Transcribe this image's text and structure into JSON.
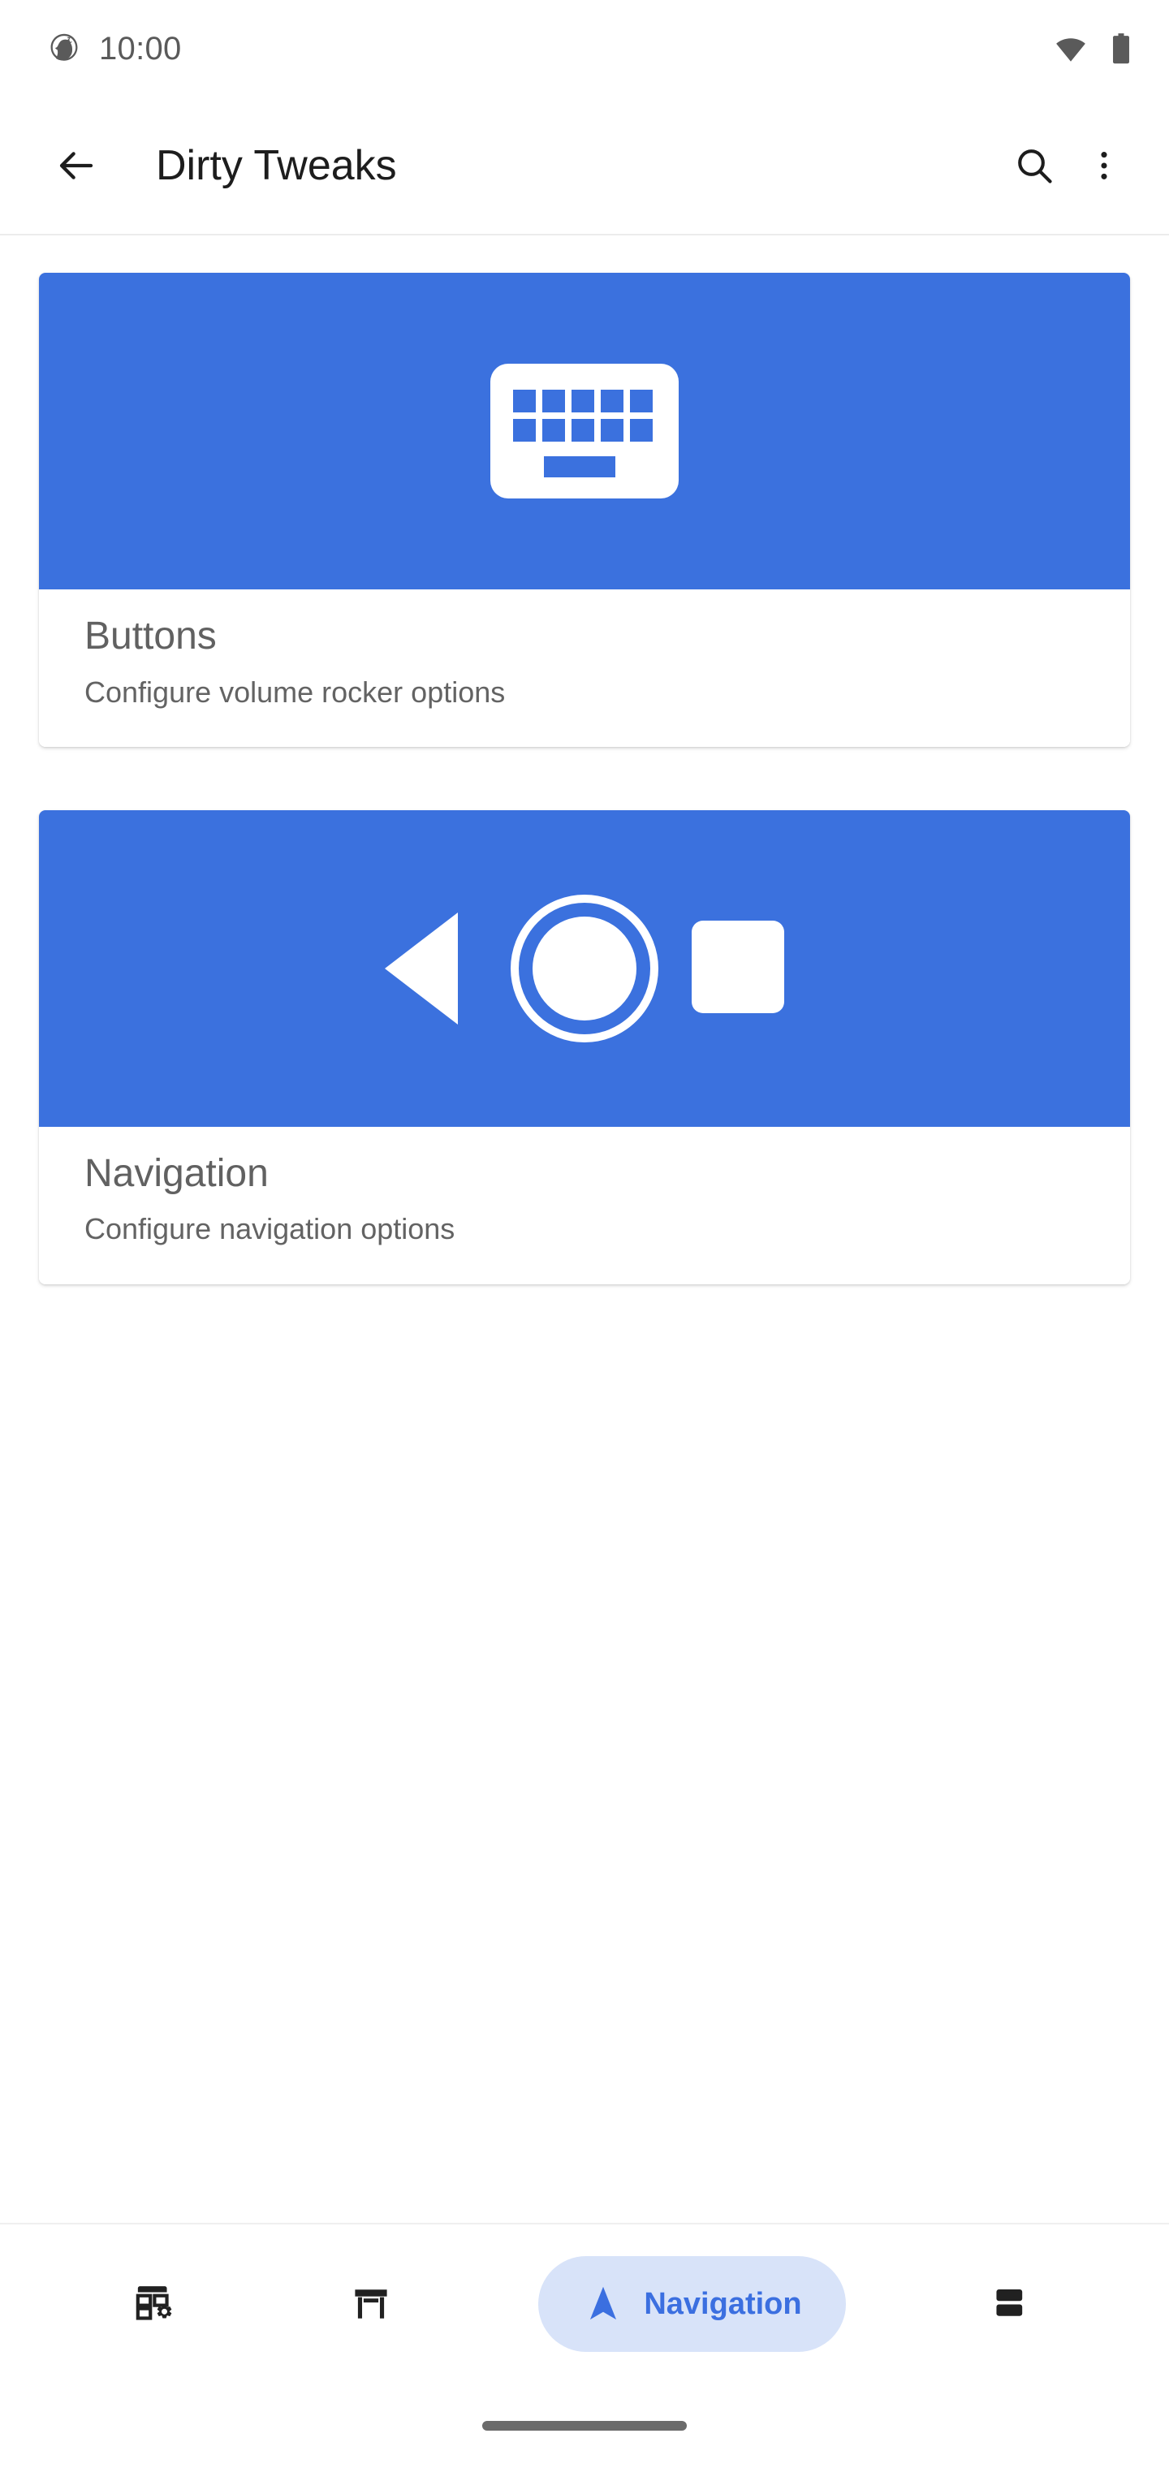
{
  "status_bar": {
    "clock": "10:00",
    "app_icon": "unicorn-icon",
    "wifi_icon": "wifi-full-icon",
    "battery_icon": "battery-full-icon"
  },
  "app_bar": {
    "back_icon": "back-arrow-icon",
    "title": "Dirty Tweaks",
    "search_icon": "search-icon",
    "overflow_icon": "more-vert-icon"
  },
  "colors": {
    "banner_blue": "#3b71de",
    "accent_blue": "#3b6fe0",
    "pill_blue": "#d8e3f9",
    "title_gray": "#616161",
    "subtitle_gray": "#636363",
    "status_gray": "#5a5a5a"
  },
  "cards": [
    {
      "icon": "keyboard-icon",
      "title": "Buttons",
      "subtitle": "Configure volume rocker options"
    },
    {
      "icon": "navigation-bar-icon",
      "title": "Navigation",
      "subtitle": "Configure navigation options"
    }
  ],
  "bottom_nav": {
    "items": [
      {
        "icon": "dashboard-customize-icon",
        "label": "",
        "active": false
      },
      {
        "icon": "status-bar-icon",
        "label": "",
        "active": false
      },
      {
        "icon": "navigation-arrow-icon",
        "label": "Navigation",
        "active": true
      },
      {
        "icon": "split-rows-icon",
        "label": "",
        "active": false
      }
    ]
  },
  "gesture_bar": {
    "present": true
  }
}
